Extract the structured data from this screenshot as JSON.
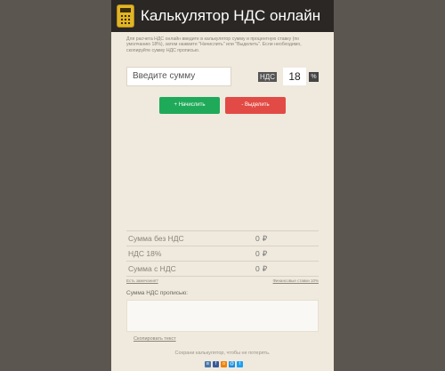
{
  "header": {
    "title": "Калькулятор НДС онлайн",
    "icon": "calculator-icon",
    "icon_color": "#e2b526"
  },
  "description": "Для расчета НДС онлайн введите в калькулятор сумму и процентную ставку (по умолчанию 18%), затем нажмите \"Начислить\" или \"Выделить\". Если необходимо, скопируйте сумму НДС прописью.",
  "form": {
    "sum_placeholder": "Введите сумму",
    "nds_label": "НДС",
    "rate_value": "18",
    "percent_sign": "%"
  },
  "buttons": {
    "add": "+ Начислить",
    "subtract": "- Выделить",
    "add_color": "#1faa5a",
    "subtract_color": "#e24b45"
  },
  "results": [
    {
      "label": "Сумма без НДС",
      "value": "0",
      "currency": "₽"
    },
    {
      "label": "НДС 18%",
      "value": "0",
      "currency": "₽"
    },
    {
      "label": "Сумма с НДС",
      "value": "0",
      "currency": "₽"
    }
  ],
  "links": {
    "left": "Есть замечания?",
    "right": "Финансовые ставки 10%"
  },
  "words": {
    "label": "Сумма НДС прописью:",
    "value": ""
  },
  "copy_link": "Скопировать текст",
  "save_text": "Сохрани калькулятор, чтобы не потерять.",
  "share_icons": [
    {
      "name": "vk-icon",
      "color": "#4a76a8",
      "glyph": "в"
    },
    {
      "name": "facebook-icon",
      "color": "#3b5998",
      "glyph": "f"
    },
    {
      "name": "odnoklassniki-icon",
      "color": "#ee8208",
      "glyph": "о"
    },
    {
      "name": "mailru-icon",
      "color": "#168de2",
      "glyph": "@"
    },
    {
      "name": "twitter-icon",
      "color": "#1da1f2",
      "glyph": "t"
    }
  ]
}
